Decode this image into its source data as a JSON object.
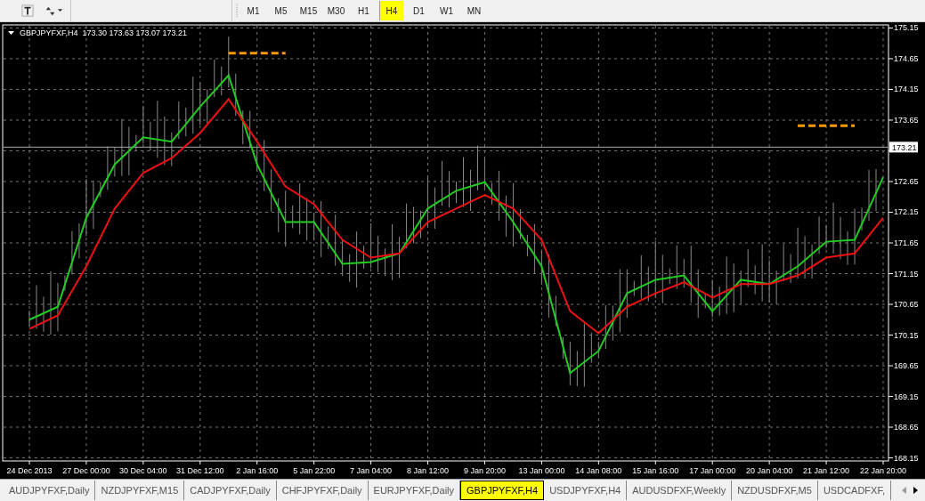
{
  "toolbar": {
    "timeframes": [
      {
        "label": "M1",
        "selected": false
      },
      {
        "label": "M5",
        "selected": false
      },
      {
        "label": "M15",
        "selected": false
      },
      {
        "label": "M30",
        "selected": false
      },
      {
        "label": "H1",
        "selected": false
      },
      {
        "label": "H4",
        "selected": true
      },
      {
        "label": "D1",
        "selected": false
      },
      {
        "label": "W1",
        "selected": false
      },
      {
        "label": "MN",
        "selected": false
      }
    ]
  },
  "chart": {
    "header": "GBPJPYFXF,H4  173.30 173.63 173.07 173.21",
    "current_price": "173.21",
    "chart_data": {
      "type": "line",
      "grid": true,
      "categories": [
        "24 Dec 2013",
        null,
        "27 Dec 00:00",
        null,
        "30 Dec 04:00",
        null,
        "31 Dec 12:00",
        null,
        "2 Jan 16:00",
        null,
        "5 Jan 22:00",
        null,
        "7 Jan 04:00",
        null,
        "8 Jan 12:00",
        null,
        "9 Jan 20:00",
        null,
        "13 Jan 00:00",
        null,
        "14 Jan 08:00",
        null,
        "15 Jan 16:00",
        null,
        "17 Jan 00:00",
        null,
        "20 Jan 04:00",
        null,
        "21 Jan 12:00",
        null,
        "22 Jan 20:00"
      ],
      "ref_lines": [
        {
          "axis": "y",
          "value": 173.21,
          "color": "#aaaaaa"
        }
      ],
      "yticks": [
        {
          "value": 175.15,
          "label": "175.15"
        },
        {
          "value": 174.65,
          "label": "174.65"
        },
        {
          "value": 174.15,
          "label": "174.15"
        },
        {
          "value": 173.65,
          "label": "173.65"
        },
        {
          "value": 172.65,
          "label": "172.65"
        },
        {
          "value": 172.15,
          "label": "172.15"
        },
        {
          "value": 171.65,
          "label": "171.65"
        },
        {
          "value": 171.15,
          "label": "171.15"
        },
        {
          "value": 170.65,
          "label": "170.65"
        },
        {
          "value": 170.15,
          "label": "170.15"
        },
        {
          "value": 169.65,
          "label": "169.65"
        },
        {
          "value": 169.15,
          "label": "169.15"
        },
        {
          "value": 168.65,
          "label": "168.65"
        },
        {
          "value": 168.15,
          "label": "168.15"
        }
      ],
      "ylim": [
        168.1,
        175.2
      ],
      "series": [
        {
          "color": "#22cc22",
          "values": [
            170.4,
            170.61,
            172.06,
            172.93,
            173.37,
            173.3,
            173.87,
            174.38,
            172.93,
            171.99,
            171.99,
            171.31,
            171.34,
            171.48,
            172.21,
            172.5,
            172.64,
            171.99,
            171.27,
            169.53,
            169.89,
            170.83,
            171.05,
            171.12,
            170.54,
            171.05,
            170.98,
            171.27,
            171.67,
            171.7,
            172.72
          ]
        },
        {
          "color": "#ee1111",
          "values": [
            170.25,
            170.47,
            171.27,
            172.21,
            172.79,
            173.03,
            173.44,
            173.99,
            173.3,
            172.57,
            172.28,
            171.7,
            171.41,
            171.48,
            171.99,
            172.21,
            172.43,
            172.21,
            171.7,
            170.54,
            170.18,
            170.61,
            170.83,
            171.01,
            170.76,
            170.98,
            170.98,
            171.12,
            171.41,
            171.48,
            172.06
          ]
        },
        {
          "color": "#ff9900",
          "line_style": "dashed",
          "values": [
            null,
            null,
            null,
            null,
            null,
            null,
            null,
            174.74,
            174.74,
            174.74,
            null,
            null,
            null,
            null,
            null,
            null,
            null,
            null,
            null,
            null,
            null,
            null,
            null,
            null,
            null,
            null,
            null,
            173.56,
            173.56,
            173.56,
            null
          ]
        }
      ]
    }
  },
  "symbol_tabs": [
    {
      "label": "AUDJPYFXF,Daily",
      "selected": false
    },
    {
      "label": "NZDJPYFXF,M15",
      "selected": false
    },
    {
      "label": "CADJPYFXF,Daily",
      "selected": false
    },
    {
      "label": "CHFJPYFXF,Daily",
      "selected": false
    },
    {
      "label": "EURJPYFXF,Daily",
      "selected": false
    },
    {
      "label": "GBPJPYFXF,H4",
      "selected": true
    },
    {
      "label": "USDJPYFXF,H4",
      "selected": false
    },
    {
      "label": "AUDUSDFXF,Weekly",
      "selected": false
    },
    {
      "label": "NZDUSDFXF,M5",
      "selected": false
    },
    {
      "label": "USDCADFXF,",
      "selected": false
    }
  ]
}
